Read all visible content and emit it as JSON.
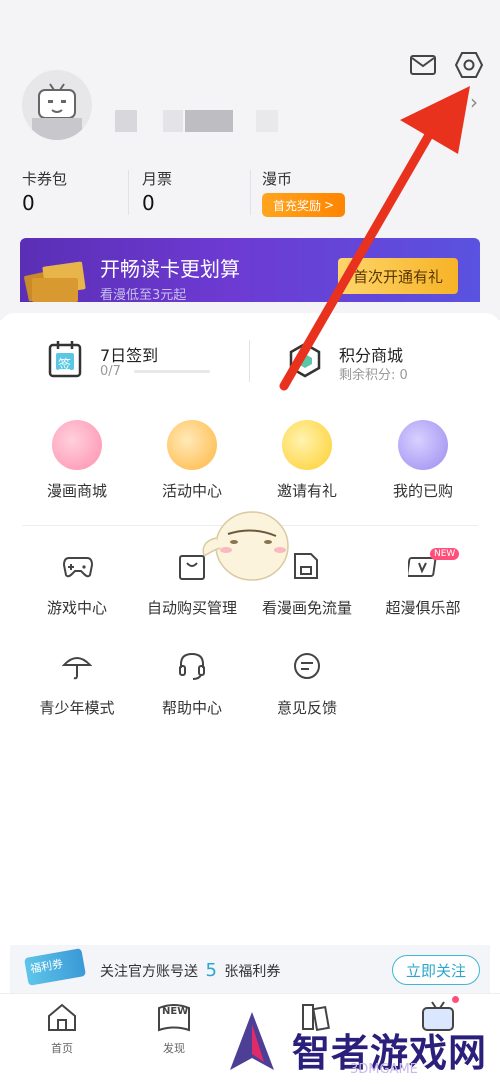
{
  "stats": {
    "coupon_label": "卡券包",
    "coupon_value": "0",
    "ticket_label": "月票",
    "ticket_value": "0",
    "coin_label": "漫币",
    "recharge_label": "首充奖励",
    "chevron": "›"
  },
  "banner": {
    "title": "开畅读卡更划算",
    "subtitle": "看漫低至3元起",
    "button": "首次开通有礼"
  },
  "checkin": {
    "title": "7日签到",
    "progress_text": "0/7",
    "progress": 0,
    "icon_char": "签"
  },
  "points": {
    "title": "积分商城",
    "remaining": "剩余积分: 0"
  },
  "grid_row1": [
    {
      "label": "漫画商城",
      "color": "#ff8fae",
      "icon": "shopping-bag-icon"
    },
    {
      "label": "活动中心",
      "color": "#ffb640",
      "icon": "gift-icon"
    },
    {
      "label": "邀请有礼",
      "color": "#ffce2a",
      "icon": "invite-card-icon"
    },
    {
      "label": "我的已购",
      "color": "#9b8cf0",
      "icon": "purchased-book-icon"
    }
  ],
  "grid_row2": [
    {
      "label": "游戏中心",
      "icon": "gamepad-icon"
    },
    {
      "label": "自动购买管理",
      "icon": "auto-buy-bag-icon"
    },
    {
      "label": "看漫画免流量",
      "icon": "sim-card-icon"
    },
    {
      "label": "超漫俱乐部",
      "icon": "vip-club-icon",
      "badge": "NEW"
    }
  ],
  "grid_row3": [
    {
      "label": "青少年模式",
      "icon": "umbrella-icon"
    },
    {
      "label": "帮助中心",
      "icon": "headset-icon"
    },
    {
      "label": "意见反馈",
      "icon": "feedback-icon"
    }
  ],
  "follow_banner": {
    "text_before": "关注官方账号送",
    "count": "5",
    "text_after": "张福利券",
    "ticket_text": "福利券",
    "button": "立即关注"
  },
  "nav": [
    {
      "label": "首页",
      "icon": "home-icon"
    },
    {
      "label": "发现",
      "icon": "discover-new-icon",
      "badge": "NEW"
    },
    {
      "label": "",
      "icon": "bookshelf-icon"
    },
    {
      "label": "",
      "icon": "profile-tv-icon"
    }
  ],
  "watermark": {
    "brand": "智者游戏网",
    "sub": "3DMGAME"
  },
  "colors": {
    "accent_cyan": "#2aa7cc",
    "orange": "#ff8400",
    "arrow_red": "#e8321e",
    "purple": "#5a2fb5"
  }
}
